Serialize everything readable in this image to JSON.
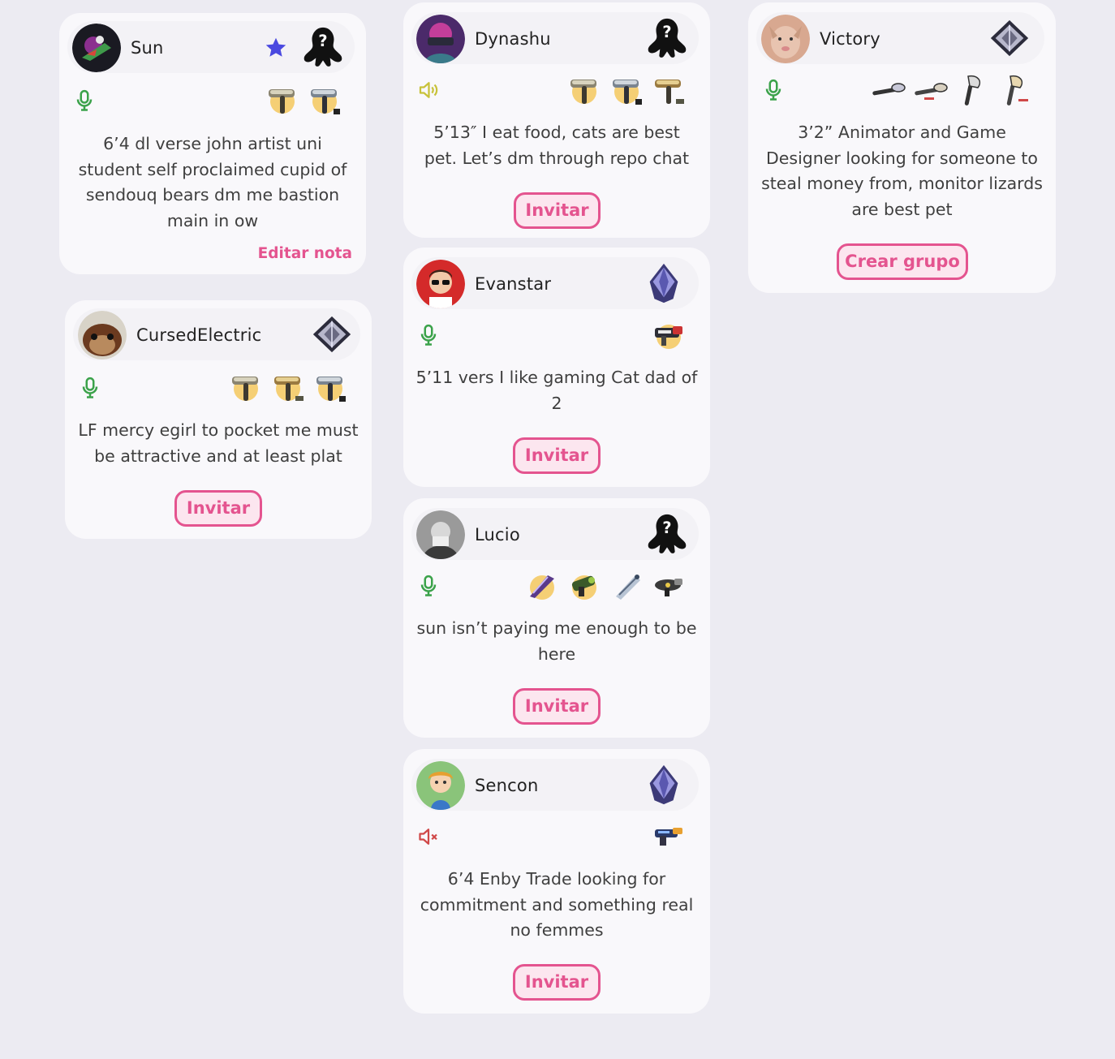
{
  "cards": [
    {
      "username": "Sun",
      "bio": "6’4 dl verse john artist uni student self proclaimed cupid of sendouq bears dm me bastion main in ow",
      "action": "Editar nota",
      "voice": "mic",
      "rank": "unknown",
      "weapons": [
        "splat-roller",
        "splat-roller-variant"
      ]
    },
    {
      "username": "CursedElectric",
      "bio": "LF mercy egirl to pocket me must be attractive and at least plat",
      "action": "Invitar",
      "voice": "mic",
      "rank": "silver-diamond",
      "weapons": [
        "splat-roller",
        "splat-roller-variant",
        "splat-roller-variant-2"
      ]
    },
    {
      "username": "Dynashu",
      "bio": "5’13″ I eat food, cats are best pet. Let’s dm through repo chat",
      "action": "Invitar",
      "voice": "listen",
      "rank": "unknown",
      "weapons": [
        "splat-roller",
        "splat-roller-variant",
        "splat-roller-variant-2"
      ]
    },
    {
      "username": "Evanstar",
      "bio": "5’11 vers I like gaming Cat dad of 2",
      "action": "Invitar",
      "voice": "mic",
      "rank": "purple-diamond",
      "weapons": [
        "splattershot-pro"
      ]
    },
    {
      "username": "Lucio",
      "bio": "sun isn’t paying me enough to be here",
      "action": "Invitar",
      "voice": "mic",
      "rank": "unknown",
      "weapons": [
        "splatana-wiper",
        "blaster",
        "tri-stringer",
        "bloblobber"
      ]
    },
    {
      "username": "Sencon",
      "bio": "6’4 Enby Trade looking for commitment and something real no femmes",
      "action": "Invitar",
      "voice": "muted",
      "rank": "purple-diamond",
      "weapons": [
        "splattershot"
      ]
    },
    {
      "username": "Victory",
      "bio": "3’2” Animator and Game Designer looking for someone to steal money from, monitor lizards are best pet",
      "action": "Crear grupo",
      "voice": "mic",
      "rank": "silver-diamond",
      "weapons": [
        "inkbrush",
        "inkbrush-variant",
        "octobrush",
        "octobrush-variant"
      ]
    }
  ],
  "colors": {
    "accent": "#e4548f",
    "mic": "#3ba24a",
    "listen": "#c8c23a",
    "muted": "#d04848",
    "star": "#4a49e0",
    "background": "#ecebf2"
  },
  "icons": {
    "favorite": "star-icon",
    "mic": "microphone-icon",
    "listen": "speaker-icon",
    "muted": "speaker-muted-icon"
  }
}
